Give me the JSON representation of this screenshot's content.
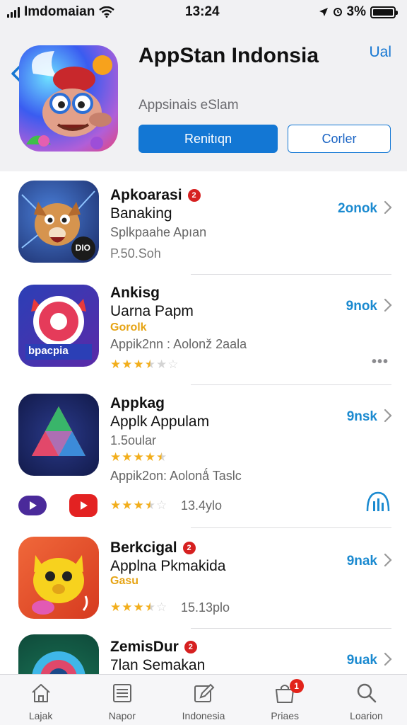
{
  "status_bar": {
    "carrier": "Imdomaian",
    "time": "13:24",
    "battery": "3%"
  },
  "header": {
    "app_title": "AppStan Indonsia",
    "subtitle": "Appsinais eSlam",
    "top_right_link": "Ual",
    "primary_button": "Renitıqn",
    "secondary_button": "Corler"
  },
  "list": [
    {
      "name": "Apkoarasi",
      "title2": "Banaking",
      "subtitle": "Splkpaahe Apıan",
      "meta": "P.50.Soh",
      "badge": "2",
      "get_label": "2onok",
      "icon_label": "DIO"
    },
    {
      "name": "Ankisg",
      "title2": "Uarna Papm",
      "tag": "Gorolk",
      "subtitle": "Appik2nn : Aolonž 2aala",
      "rating": 3.5,
      "get_label": "9nok",
      "icon_label": "bpacpia"
    },
    {
      "name": "Appkag",
      "title2": "Applk Appulam",
      "subtitle": "1.5oular",
      "rating": 4.5,
      "extra": "Appik2on: Aolonǻ Taslc",
      "rating2": 3.5,
      "meta": "13.4ylo",
      "get_label": "9nsk"
    },
    {
      "name": "Berkcigal",
      "title2": "Applna Pkmakida",
      "tag": "Gasu",
      "rating": 3.5,
      "meta": "15.13plo",
      "badge": "2",
      "get_label": "9nak"
    },
    {
      "name": "ZemisDur",
      "title2": "7lan Semakan",
      "badge": "2",
      "get_label": "9uak"
    }
  ],
  "tabs": [
    {
      "label": "Lajak",
      "icon": "home-icon"
    },
    {
      "label": "Napor",
      "icon": "list-icon"
    },
    {
      "label": "Indonesia",
      "icon": "edit-icon"
    },
    {
      "label": "Priaes",
      "icon": "bag-icon",
      "badge": "1"
    },
    {
      "label": "Loarion",
      "icon": "search-icon"
    }
  ],
  "colors": {
    "accent": "#1377d4",
    "get_link": "#1b8ad0",
    "star": "#f2ae1c",
    "badge": "#d62020"
  }
}
